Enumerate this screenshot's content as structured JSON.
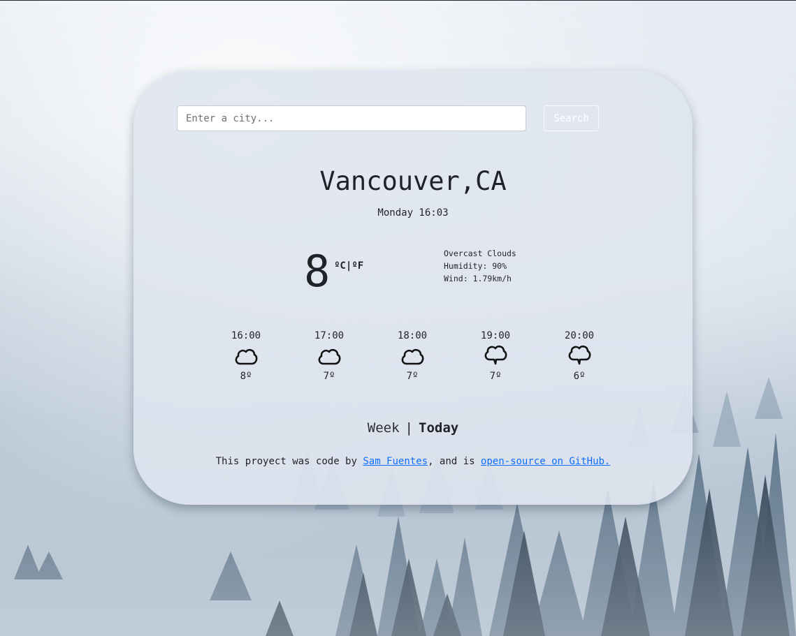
{
  "search": {
    "placeholder": "Enter a city...",
    "button_label": "Search"
  },
  "current": {
    "city": "Vancouver,CA",
    "datetime": "Monday 16:03",
    "temperature": "8",
    "unit_celsius": "ºC",
    "unit_separator": "|",
    "unit_fahrenheit": "ºF",
    "description": "Overcast Clouds",
    "humidity": "Humidity: 90%",
    "wind": "Wind: 1.79km/h"
  },
  "forecast": [
    {
      "time": "16:00",
      "temp": "8º",
      "icon": "cloud-icon"
    },
    {
      "time": "17:00",
      "temp": "7º",
      "icon": "cloud-icon"
    },
    {
      "time": "18:00",
      "temp": "7º",
      "icon": "cloud-icon"
    },
    {
      "time": "19:00",
      "temp": "7º",
      "icon": "chat-cloud-icon"
    },
    {
      "time": "20:00",
      "temp": "6º",
      "icon": "chat-cloud-icon"
    }
  ],
  "toggle": {
    "week_label": "Week",
    "separator": "|",
    "today_label": "Today"
  },
  "footer": {
    "text_before": "This proyect was code by ",
    "author_link": "Sam Fuentes",
    "text_middle": ", and is ",
    "github_link": "open-source on GitHub."
  },
  "colors": {
    "card_background": "#dfe5ef",
    "link": "#0d6efd",
    "text": "#1f2328"
  }
}
